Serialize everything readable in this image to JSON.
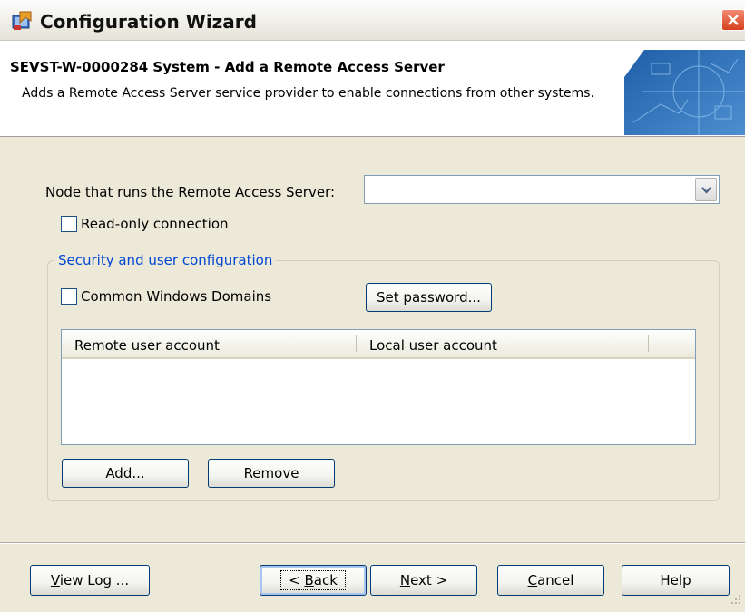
{
  "window": {
    "title": "Configuration Wizard"
  },
  "header": {
    "title": "SEVST-W-0000284 System - Add a Remote Access Server",
    "description": "Adds a Remote Access Server service provider to enable connections from other systems."
  },
  "node": {
    "label": "Node that runs the Remote Access Server:",
    "value": ""
  },
  "readonly": {
    "label": "Read-only connection",
    "checked": false
  },
  "security": {
    "legend": "Security and user configuration",
    "common_domains_label": "Common Windows Domains",
    "set_password_label": "Set password...",
    "columns": [
      "Remote user account",
      "Local user account"
    ],
    "rows": [],
    "add_label": "Add...",
    "remove_label": "Remove"
  },
  "footer": {
    "view_log": {
      "prefix": "V",
      "rest": "iew Log ..."
    },
    "back": {
      "pre": "< ",
      "key": "B",
      "rest": "ack"
    },
    "next": {
      "key": "N",
      "rest": "ext >"
    },
    "cancel": {
      "key": "C",
      "rest": "ancel"
    },
    "help_label": "Help"
  },
  "colors": {
    "accent_legend": "#0046d5",
    "dialog_bg": "#ece9d8",
    "close_button": "#d6401c"
  }
}
